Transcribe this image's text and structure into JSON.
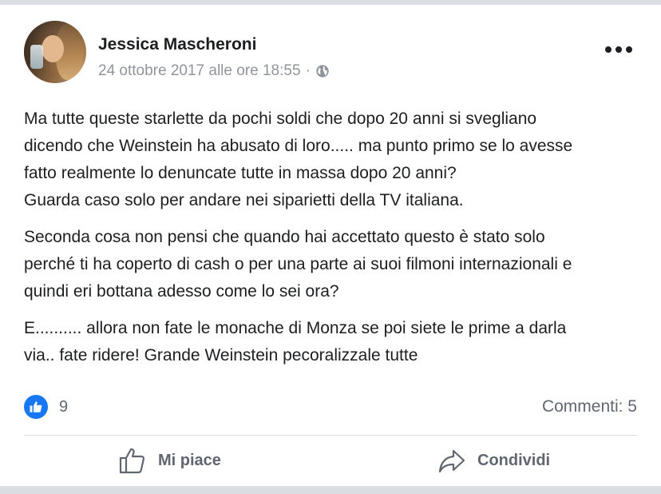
{
  "post": {
    "author": {
      "name": "Jessica Mascheroni",
      "avatar_icon": "profile-photo"
    },
    "timestamp": "24 ottobre 2017 alle ore 18:55",
    "separator": "·",
    "privacy_icon": "globe-icon",
    "menu_icon": "more-options-icon",
    "paragraphs": [
      "Ma tutte queste starlette da pochi soldi che dopo 20 anni si svegliano\ndicendo che Weinstein ha abusato di loro..... ma punto primo se lo avesse\nfatto realmente lo denuncate tutte in massa dopo 20 anni?\nGuarda caso solo per andare nei siparietti della TV italiana.",
      "Seconda cosa non pensi che quando hai accettato questo è stato solo\nperché ti ha coperto di cash o per una parte ai suoi filmoni internazionali e\nquindi eri bottana adesso come lo sei ora?",
      "E.......... allora non fate le monache di Monza se poi siete le prime a darla\nvia.. fate ridere! Grande Weinstein pecoralizzale tutte"
    ],
    "reactions": {
      "icon": "like-reaction-icon",
      "count": "9"
    },
    "comments_label": "Commenti: 5",
    "actions": {
      "like_label": "Mi piace",
      "share_label": "Condividi"
    }
  },
  "colors": {
    "accent": "#1877f2",
    "text": "#1c1e21",
    "secondary_text": "#606770",
    "meta_text": "#90949c",
    "background": "#dadde1"
  }
}
